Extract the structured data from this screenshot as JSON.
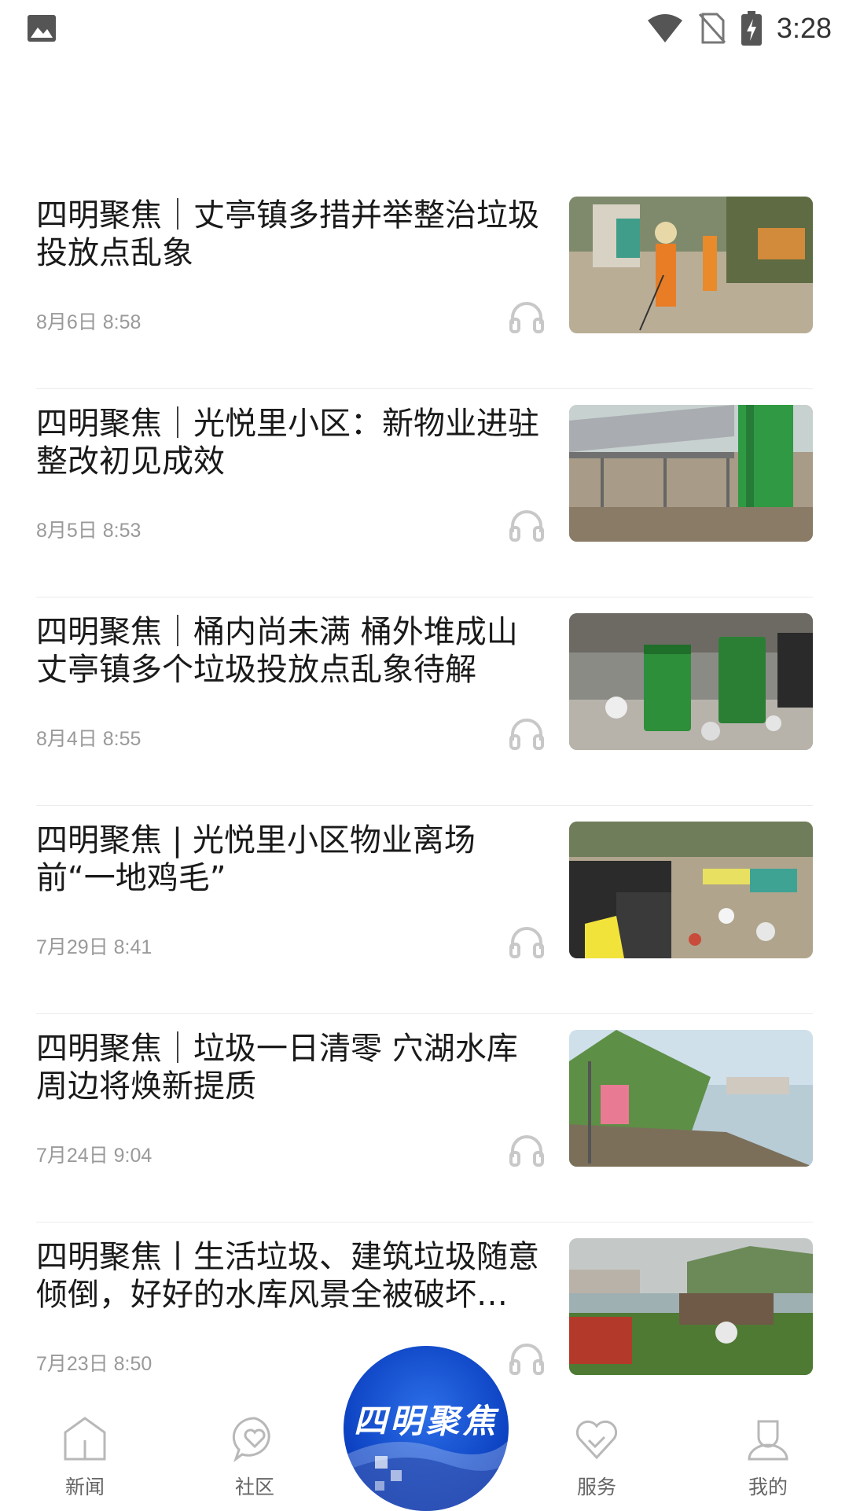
{
  "status_bar": {
    "time": "3:28",
    "icons": [
      "image-icon",
      "wifi-icon",
      "no-sim-icon",
      "battery-charging-icon"
    ]
  },
  "feed": {
    "items": [
      {
        "title": "四明聚焦｜丈亭镇多措并举整治垃圾投放点乱象",
        "date": "8月6日 8:58",
        "thumb": "workers-cleaning-photo"
      },
      {
        "title": "四明聚焦｜光悦里小区：新物业进驻 整改初见成效",
        "date": "8月5日 8:53",
        "thumb": "covered-shed-photo"
      },
      {
        "title": "四明聚焦｜桶内尚未满 桶外堆成山 丈亭镇多个垃圾投放点乱象待解",
        "date": "8月4日 8:55",
        "thumb": "green-trash-bins-photo"
      },
      {
        "title": "四明聚焦 | 光悦里小区物业离场前“一地鸡毛”",
        "date": "7月29日 8:41",
        "thumb": "scattered-garbage-photo"
      },
      {
        "title": "四明聚焦｜垃圾一日清零 穴湖水库周边将焕新提质",
        "date": "7月24日 9:04",
        "thumb": "reservoir-shore-photo"
      },
      {
        "title": "四明聚焦丨生活垃圾、建筑垃圾随意倾倒，好好的水库风景全被破坏…",
        "date": "7月23日 8:50",
        "thumb": "dumped-waste-lake-photo"
      }
    ]
  },
  "bottom_nav": {
    "items": [
      {
        "label": "新闻",
        "icon": "home-icon"
      },
      {
        "label": "社区",
        "icon": "heart-bubble-icon"
      },
      {
        "label": "服务",
        "icon": "heart-check-icon"
      },
      {
        "label": "我的",
        "icon": "user-icon"
      }
    ],
    "center_logo": {
      "text": "四明聚焦"
    }
  },
  "colors": {
    "accent": "#1a4fd6",
    "text": "#1a1a1a",
    "muted": "#9a9a9a",
    "icon": "#bdbdbd"
  }
}
